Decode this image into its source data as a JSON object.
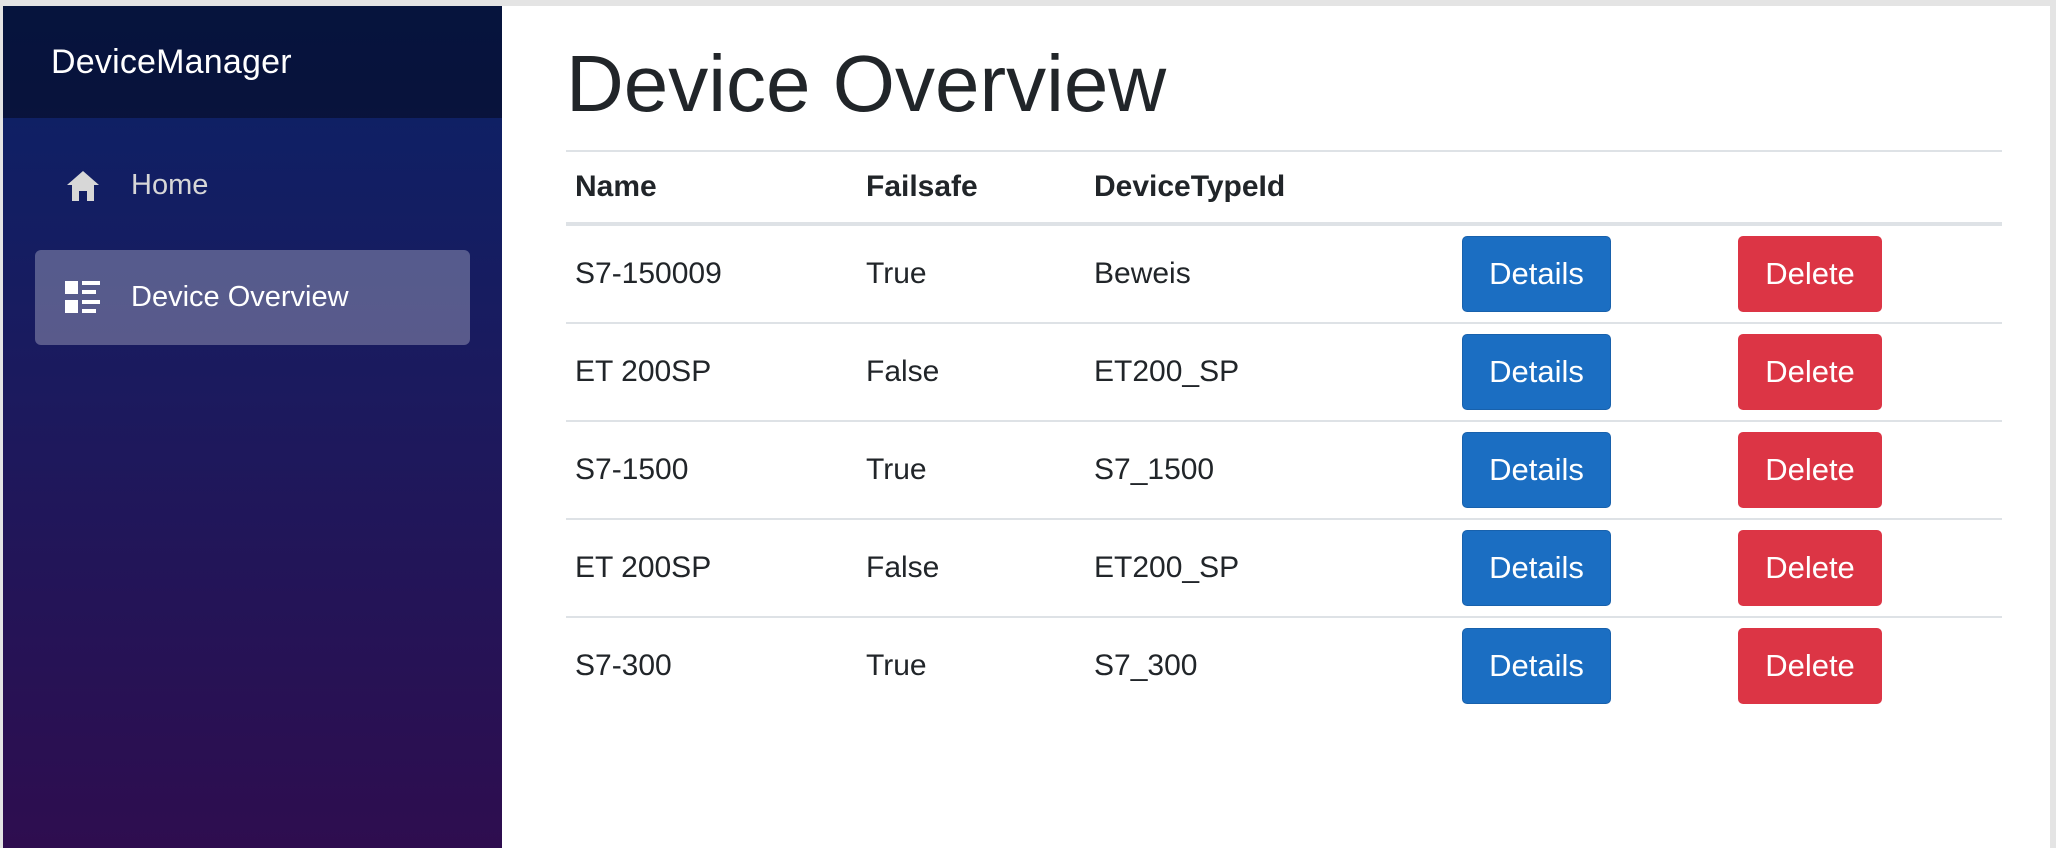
{
  "app": {
    "brand": "DeviceManager"
  },
  "nav": {
    "items": [
      {
        "label": "Home",
        "icon": "home-icon",
        "active": false
      },
      {
        "label": "Device Overview",
        "icon": "list-icon",
        "active": true
      }
    ]
  },
  "main": {
    "title": "Device Overview",
    "table": {
      "headers": [
        "Name",
        "Failsafe",
        "DeviceTypeId"
      ],
      "rows": [
        {
          "name": "S7-150009",
          "failsafe": "True",
          "device_type_id": "Beweis",
          "details_label": "Details",
          "delete_label": "Delete"
        },
        {
          "name": "ET 200SP",
          "failsafe": "False",
          "device_type_id": "ET200_SP",
          "details_label": "Details",
          "delete_label": "Delete"
        },
        {
          "name": "S7-1500",
          "failsafe": "True",
          "device_type_id": "S7_1500",
          "details_label": "Details",
          "delete_label": "Delete"
        },
        {
          "name": "ET 200SP",
          "failsafe": "False",
          "device_type_id": "ET200_SP",
          "details_label": "Details",
          "delete_label": "Delete"
        },
        {
          "name": "S7-300",
          "failsafe": "True",
          "device_type_id": "S7_300",
          "details_label": "Details",
          "delete_label": "Delete"
        }
      ]
    }
  },
  "colors": {
    "details_button": "#1b6ec2",
    "delete_button": "#dc3545",
    "sidebar_top": "#0a2267",
    "sidebar_bottom": "#2e0d4f"
  }
}
